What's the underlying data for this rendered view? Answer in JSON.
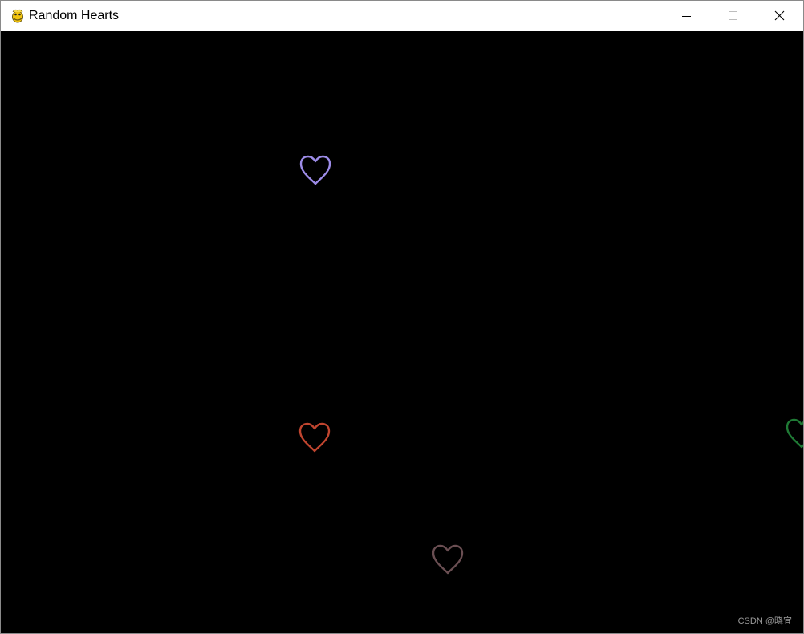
{
  "window": {
    "title": "Random Hearts",
    "controls": {
      "minimize_icon": "minimize-icon",
      "maximize_icon": "maximize-icon",
      "close_icon": "close-icon"
    }
  },
  "canvas": {
    "background": "#000000",
    "hearts": [
      {
        "color": "#9d8ce8"
      },
      {
        "color": "#c0452f"
      },
      {
        "color": "#1f7a35"
      },
      {
        "color": "#6a4e52"
      }
    ]
  },
  "watermark": {
    "text": "CSDN @晓宜"
  }
}
